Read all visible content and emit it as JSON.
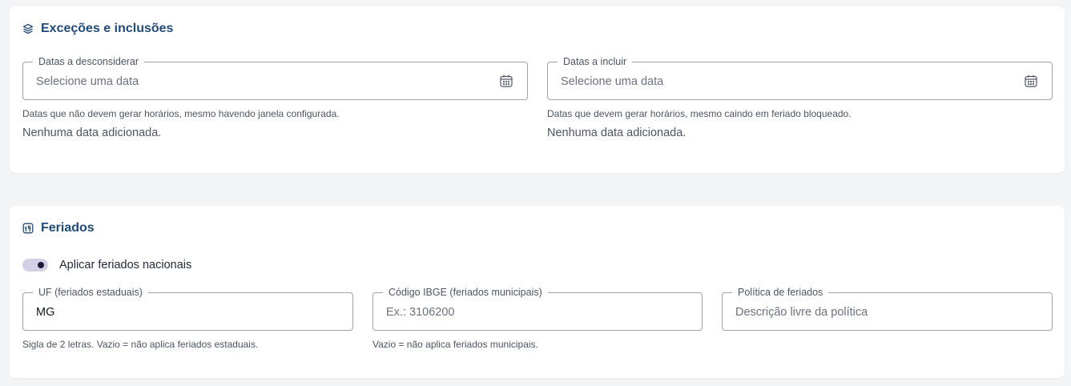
{
  "exceptions": {
    "title": "Exceções e inclusões",
    "icon": "layers-icon",
    "exclude": {
      "legend": "Datas a desconsiderar",
      "placeholder": "Selecione uma data",
      "helper": "Datas que não devem gerar horários, mesmo havendo janela configurada.",
      "empty": "Nenhuma data adicionada."
    },
    "include": {
      "legend": "Datas a incluir",
      "placeholder": "Selecione uma data",
      "helper": "Datas que devem gerar horários, mesmo caindo em feriado bloqueado.",
      "empty": "Nenhuma data adicionada."
    }
  },
  "holidays": {
    "title": "Feriados",
    "icon": "holiday-icon",
    "toggle": {
      "label": "Aplicar feriados nacionais",
      "checked": true
    },
    "uf": {
      "legend": "UF (feriados estaduais)",
      "value": "MG",
      "helper": "Sigla de 2 letras. Vazio = não aplica feriados estaduais."
    },
    "ibge": {
      "legend": "Código IBGE (feriados municipais)",
      "placeholder": "Ex.: 3106200",
      "helper": "Vazio = não aplica feriados municipais."
    },
    "policy": {
      "legend": "Política de feriados",
      "placeholder": "Descrição livre da política"
    }
  },
  "colors": {
    "title": "#1f4a7a",
    "toggle_track": "#d5cfe6",
    "toggle_knob": "#1e1b3a"
  }
}
